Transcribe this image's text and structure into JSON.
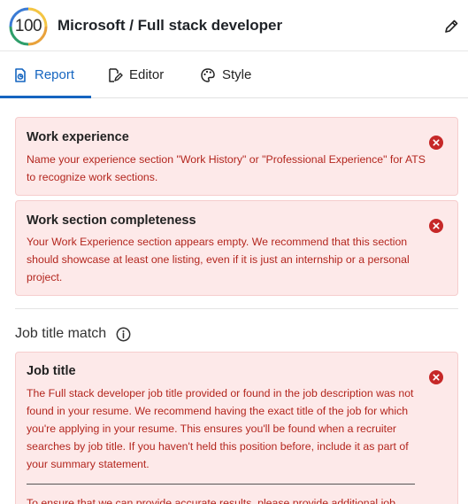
{
  "header": {
    "score": "100",
    "title": "Microsoft / Full stack developer"
  },
  "tabs": [
    {
      "label": "Report",
      "active": true
    },
    {
      "label": "Editor",
      "active": false
    },
    {
      "label": "Style",
      "active": false
    }
  ],
  "checks": [
    {
      "title": "Work experience",
      "message": "Name your experience section \"Work History\" or \"Professional Experience\" for ATS to recognize work sections."
    },
    {
      "title": "Work section completeness",
      "message": "Your Work Experience section appears empty. We recommend that this section should showcase at least one listing, even if it is just an internship or a personal project."
    }
  ],
  "job_title_match": {
    "section_title": "Job title match",
    "card": {
      "title": "Job title",
      "message": "The Full stack developer job title provided or found in the job description was not found in your resume. We recommend having the exact title of the job for which you're applying in your resume. This ensures you'll be found when a recruiter searches by job title. If you haven't held this position before, include it as part of your summary statement.",
      "note": "To ensure that we can provide accurate results, please provide additional job"
    }
  },
  "colors": {
    "accent": "#1565c0",
    "error_bg": "#fde9e9",
    "error_text": "#b3261e",
    "error_icon": "#c62828"
  },
  "icons": {
    "edit": "pencil-icon",
    "report": "report-document-icon",
    "editor": "editor-pen-icon",
    "style": "palette-icon",
    "close": "close-circle-icon",
    "info": "info-icon"
  }
}
